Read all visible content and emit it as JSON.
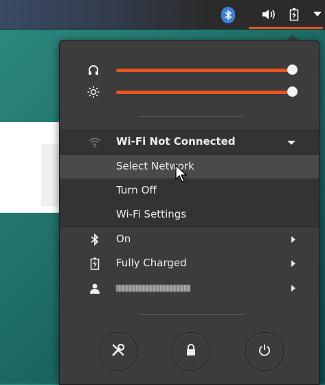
{
  "topbar": {
    "icons": [
      "bluetooth-icon",
      "volume-icon",
      "battery-charging-icon",
      "chevron-down-icon"
    ]
  },
  "sliders": [
    {
      "icon": "headphones-icon",
      "level_percent": 100
    },
    {
      "icon": "brightness-icon",
      "level_percent": 100
    }
  ],
  "wifi": {
    "title": "Wi-Fi Not Connected",
    "items": [
      "Select Network",
      "Turn Off",
      "Wi-Fi Settings"
    ]
  },
  "bluetooth": {
    "label": "On"
  },
  "power": {
    "label": "Fully Charged"
  },
  "user": {
    "icon": "user-icon"
  },
  "actions": [
    {
      "icon": "settings-tools-icon"
    },
    {
      "icon": "lock-icon"
    },
    {
      "icon": "power-icon"
    }
  ],
  "colors": {
    "accent": "#e95420",
    "panel_bg": "#3c3c3c",
    "topbar_bg": "#2b2b2b",
    "bluetooth_badge": "#3b7fd6"
  }
}
